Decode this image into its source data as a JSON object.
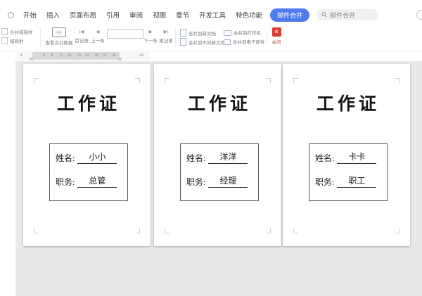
{
  "window": {
    "canvas_color": "#e9e9e9",
    "accent_blue": "#4e7bf0",
    "close_red": "#d93a31"
  },
  "menu": {
    "tabs": [
      "开始",
      "插入",
      "页面布局",
      "引用",
      "审阅",
      "视图",
      "章节",
      "开发工具",
      "特色功能"
    ],
    "active_tab": "邮件合并",
    "search_text": "邮件合并"
  },
  "toolbar": {
    "mini_buttons": [
      {
        "label": "合并域底纹"
      },
      {
        "label": "域映射"
      }
    ],
    "view_merge_data_label": "查看合并数据",
    "view_icon_glyph": "«»",
    "nav": {
      "first_label": "首记录",
      "first_glyph": "|◀",
      "prev_label": "上一条",
      "prev_glyph": "◀",
      "record_value": "",
      "next_label": "下一条",
      "next_glyph": "▶",
      "last_label": "尾记录",
      "last_glyph": "▶|"
    },
    "merge_actions": [
      {
        "label": "合并到新文档"
      },
      {
        "label": "合并到打印机"
      },
      {
        "label": "合并到不同新文档"
      },
      {
        "label": "合并到电子邮件"
      }
    ],
    "close_glyph": "×",
    "close_label": "关闭"
  },
  "ruler": {
    "numbers": [
      "4",
      "4",
      "8",
      "12",
      "16",
      "20",
      "24",
      "28",
      "32",
      "36",
      "44"
    ]
  },
  "document": {
    "pages": [
      {
        "title": "工作证",
        "fields": [
          {
            "label": "姓名:",
            "value": "小小"
          },
          {
            "label": "职务:",
            "value": "总管"
          }
        ]
      },
      {
        "title": "工作证",
        "fields": [
          {
            "label": "姓名:",
            "value": "洋洋"
          },
          {
            "label": "职务:",
            "value": "经理"
          }
        ]
      },
      {
        "title": "工作证",
        "fields": [
          {
            "label": "姓名:",
            "value": "卡卡"
          },
          {
            "label": "职务:",
            "value": "职工"
          }
        ]
      }
    ]
  }
}
